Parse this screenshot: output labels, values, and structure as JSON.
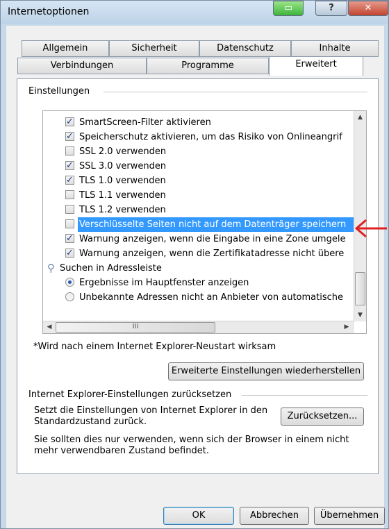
{
  "window": {
    "title": "Internetoptionen"
  },
  "tabs_row1": [
    "Allgemein",
    "Sicherheit",
    "Datenschutz",
    "Inhalte"
  ],
  "tabs_row2": [
    "Verbindungen",
    "Programme",
    "Erweitert"
  ],
  "settings": {
    "group_label": "Einstellungen",
    "items": [
      {
        "type": "checkbox",
        "checked": true,
        "label": "SmartScreen-Filter aktivieren"
      },
      {
        "type": "checkbox",
        "checked": true,
        "label": "Speicherschutz aktivieren, um das Risiko von Onlineangrif"
      },
      {
        "type": "checkbox",
        "checked": false,
        "label": "SSL 2.0 verwenden"
      },
      {
        "type": "checkbox",
        "checked": true,
        "label": "SSL 3.0 verwenden"
      },
      {
        "type": "checkbox",
        "checked": true,
        "label": "TLS 1.0 verwenden"
      },
      {
        "type": "checkbox",
        "checked": false,
        "label": "TLS 1.1 verwenden"
      },
      {
        "type": "checkbox",
        "checked": false,
        "label": "TLS 1.2 verwenden"
      },
      {
        "type": "checkbox",
        "checked": false,
        "selected": true,
        "label": "Verschlüsselte Seiten nicht auf dem Datenträger speichern"
      },
      {
        "type": "checkbox",
        "checked": true,
        "label": "Warnung anzeigen, wenn die Eingabe in eine Zone umgele"
      },
      {
        "type": "checkbox",
        "checked": true,
        "label": "Warnung anzeigen, wenn die Zertifikatadresse nicht übere"
      },
      {
        "type": "category",
        "label": "Suchen in Adressleiste"
      },
      {
        "type": "radio",
        "checked": true,
        "label": "Ergebnisse im Hauptfenster anzeigen"
      },
      {
        "type": "radio",
        "checked": false,
        "label": "Unbekannte Adressen nicht an Anbieter von automatische"
      }
    ],
    "hscroll_grip": "III",
    "restart_note": "*Wird nach einem Internet Explorer-Neustart wirksam",
    "restore_button": "Erweiterte Einstellungen wiederherstellen"
  },
  "reset": {
    "group_label": "Internet Explorer-Einstellungen zurücksetzen",
    "description_line1": "Setzt die Einstellungen von Internet Explorer in den",
    "description_line2": "Standardzustand zurück.",
    "reset_button": "Zurücksetzen...",
    "note_line1": "Sie sollten dies nur verwenden, wenn sich der Browser in einem nicht",
    "note_line2": "mehr verwendbaren Zustand befindet."
  },
  "footer": {
    "ok": "OK",
    "cancel": "Abbrechen",
    "apply": "Übernehmen"
  },
  "colors": {
    "selection": "#3399ff",
    "annotation_arrow": "#e02020"
  }
}
